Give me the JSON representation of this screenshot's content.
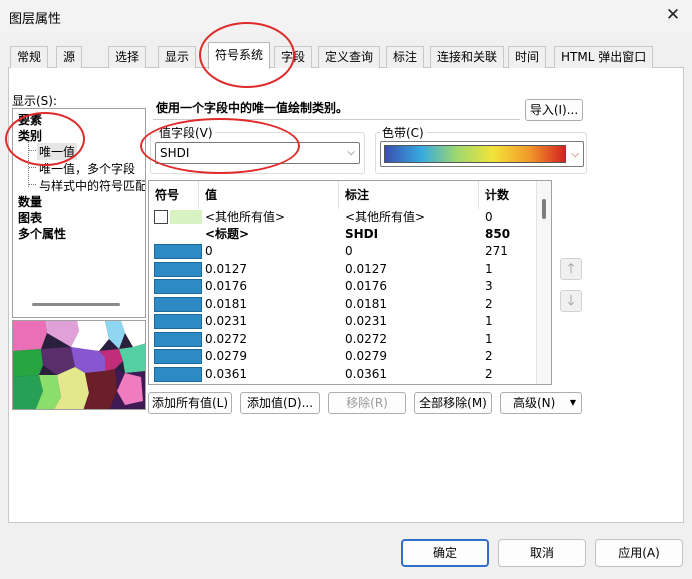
{
  "window": {
    "title": "图层属性"
  },
  "tabs": [
    {
      "label": "常规"
    },
    {
      "label": "源"
    },
    {
      "label": "选择"
    },
    {
      "label": "显示"
    },
    {
      "label": "符号系统"
    },
    {
      "label": "字段"
    },
    {
      "label": "定义查询"
    },
    {
      "label": "标注"
    },
    {
      "label": "连接和关联"
    },
    {
      "label": "时间"
    },
    {
      "label": "HTML 弹出窗口"
    }
  ],
  "active_tab": "符号系统",
  "show": {
    "label": "显示(S):",
    "items": [
      {
        "label": "要素",
        "bold": true
      },
      {
        "label": "类别",
        "bold": true
      },
      {
        "label": "唯一值",
        "bold": false,
        "selected": true
      },
      {
        "label": "唯一值，多个字段",
        "bold": false
      },
      {
        "label": "与样式中的符号匹配",
        "bold": false
      },
      {
        "label": "数量",
        "bold": true
      },
      {
        "label": "图表",
        "bold": true
      },
      {
        "label": "多个属性",
        "bold": true
      }
    ]
  },
  "description": "使用一个字段中的唯一值绘制类别。",
  "import_button": "导入(I)...",
  "value_field": {
    "label": "值字段(V)",
    "value": "SHDI"
  },
  "color_ramp": {
    "label": "色带(C)",
    "colors": [
      "#3a4fb0",
      "#36a9e0",
      "#9fd86e",
      "#f2e33a",
      "#f29a2a",
      "#d2231f"
    ]
  },
  "table": {
    "headers": {
      "symbol": "符号",
      "value": "值",
      "label": "标注",
      "count": "计数"
    },
    "other_row": {
      "value": "<其他所有值>",
      "label": "<其他所有值>",
      "count": "0"
    },
    "heading_row": {
      "value": "<标题>",
      "label": "SHDI",
      "count": "850"
    },
    "rows": [
      {
        "value": "0",
        "label": "0",
        "count": "271"
      },
      {
        "value": "0.0127",
        "label": "0.0127",
        "count": "1"
      },
      {
        "value": "0.0176",
        "label": "0.0176",
        "count": "3"
      },
      {
        "value": "0.0181",
        "label": "0.0181",
        "count": "2"
      },
      {
        "value": "0.0231",
        "label": "0.0231",
        "count": "1"
      },
      {
        "value": "0.0272",
        "label": "0.0272",
        "count": "1"
      },
      {
        "value": "0.0279",
        "label": "0.0279",
        "count": "2"
      },
      {
        "value": "0.0361",
        "label": "0.0361",
        "count": "2"
      }
    ],
    "swatch_color": "#2e8ac4"
  },
  "actions": {
    "add_all": "添加所有值(L)",
    "add_values": "添加值(D)...",
    "remove": "移除(R)",
    "remove_all": "全部移除(M)",
    "advanced": "高级(N)"
  },
  "footer": {
    "ok": "确定",
    "cancel": "取消",
    "apply": "应用(A)"
  },
  "annotation_color": "#e02b2b"
}
